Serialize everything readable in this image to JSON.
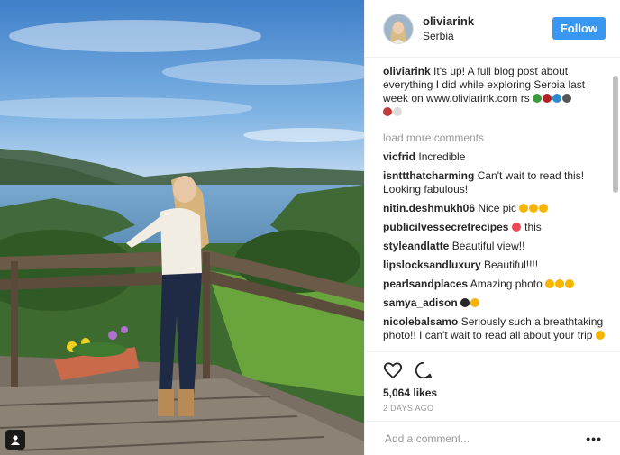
{
  "post": {
    "username": "oliviarink",
    "location": "Serbia",
    "follow_label": "Follow",
    "caption_user": "oliviarink",
    "caption_text": "It's up! A full blog post about everything I did while exploring Serbia last week on www.oliviarink.com",
    "caption_suffix": "rs",
    "load_more": "load more comments",
    "comments": [
      {
        "user": "vicfrid",
        "text": "Incredible"
      },
      {
        "user": "isnttthatcharming",
        "text": "Can't wait to read this! Looking fabulous!"
      },
      {
        "user": "nitin.deshmukh06",
        "text": "Nice pic"
      },
      {
        "user": "publicilvessecretrecipes",
        "text": "this"
      },
      {
        "user": "styleandlatte",
        "text": "Beautiful view!!"
      },
      {
        "user": "lipslocksandluxury",
        "text": "Beautiful!!!!"
      },
      {
        "user": "pearlsandplaces",
        "text": "Amazing photo"
      },
      {
        "user": "samya_adison",
        "text": ""
      },
      {
        "user": "nicolebalsamo",
        "text": "Seriously such a breathtaking photo!! I can't wait to read all about your trip"
      }
    ],
    "likes": "5,064 likes",
    "time": "2 DAYS AGO",
    "comment_placeholder": "Add a comment...",
    "more_label": "•••"
  },
  "colors": {
    "accent": "#3897f0",
    "heart_red": "#ed4956",
    "emoji_yellow": "#f7b500"
  },
  "icons": [
    "heart-icon",
    "comment-icon",
    "user-tag-icon",
    "more-options-icon"
  ]
}
